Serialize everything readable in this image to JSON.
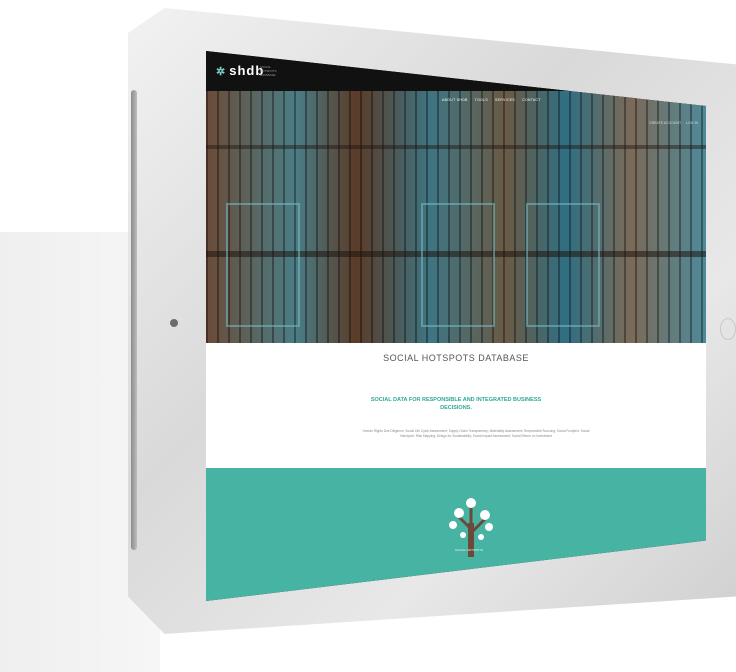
{
  "site": {
    "logo_text": "shdb",
    "logo_subtext": "SOCIAL HOTSPOTS DATABASE",
    "menu": [
      "ABOUT SHDB",
      "TOOLS",
      "SERVICES",
      "CONTACT"
    ],
    "utility": [
      "CREATE ACCOUNT",
      "LOG IN"
    ]
  },
  "content": {
    "title": "SOCIAL HOTSPOTS DATABASE",
    "tagline": "SOCIAL DATA FOR RESPONSIBLE AND INTEGRATED BUSINESS DECISIONS.",
    "keywords": "Human Rights Due Diligence; Social Life Cycle Assessment; Supply Chain Transparency; Materiality Assessment; Responsible Sourcing; Social Footprint; Social Handprint; Risk Mapping; Design for Sustainability; Social Impact Assessment; Social Return on Investment"
  },
  "footer": {
    "caption": "SOCIAL HOTSPOTS"
  },
  "colors": {
    "accent": "#47b3a3",
    "tagline": "#2fa893",
    "nav": "#111111"
  }
}
